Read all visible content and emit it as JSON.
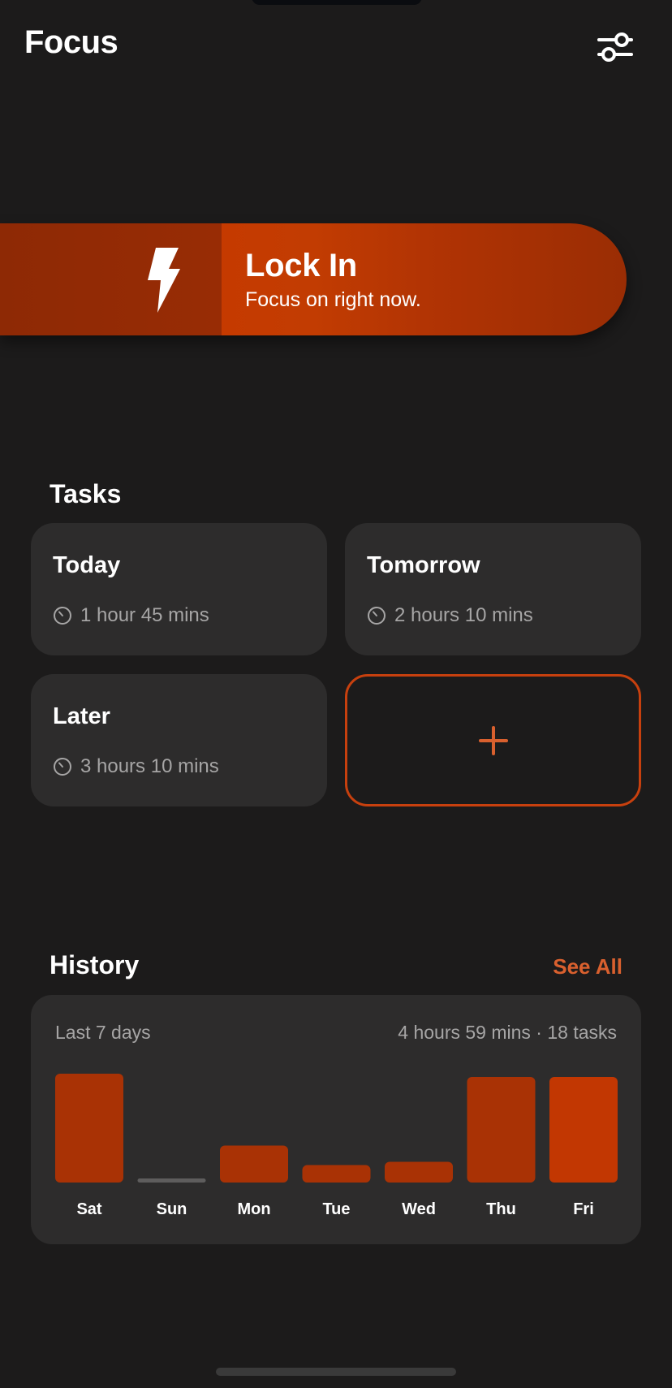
{
  "header": {
    "title": "Focus",
    "settings_icon": "sliders-icon"
  },
  "lock_in": {
    "title": "Lock In",
    "subtitle": "Focus on right now.",
    "icon": "bolt-icon",
    "colors": {
      "primary": "#c63a00",
      "dark": "#8d2a06"
    }
  },
  "tasks": {
    "title": "Tasks",
    "cards": [
      {
        "name": "Today",
        "duration": "1 hour 45 mins"
      },
      {
        "name": "Tomorrow",
        "duration": "2 hours 10 mins"
      },
      {
        "name": "Later",
        "duration": "3 hours 10 mins"
      }
    ],
    "add_icon": "plus-icon",
    "accent": "#c7400e"
  },
  "history": {
    "title": "History",
    "see_all": "See All",
    "range": "Last 7 days",
    "summary": "4 hours 59 mins · 18 tasks"
  },
  "chart_data": {
    "type": "bar",
    "categories": [
      "Sat",
      "Sun",
      "Mon",
      "Tue",
      "Wed",
      "Thu",
      "Fri"
    ],
    "values": [
      100,
      3,
      34,
      16,
      19,
      97,
      97
    ],
    "ylim": [
      0,
      100
    ],
    "grid": false,
    "colors": {
      "bar": "#a93205",
      "highlight": "#c23702",
      "empty": "#5e5d5d"
    },
    "highlight_index": 6
  }
}
